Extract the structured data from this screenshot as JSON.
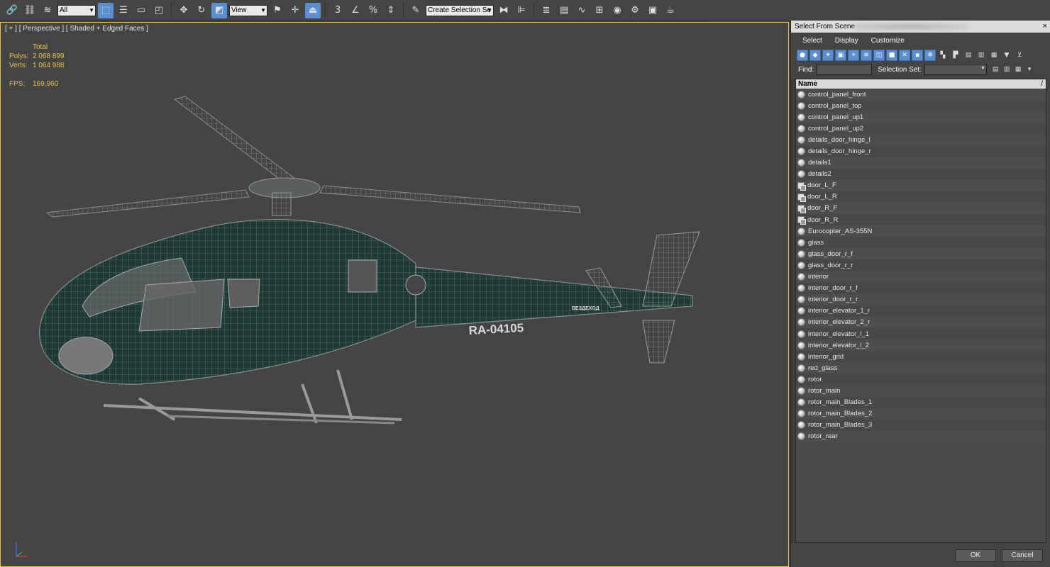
{
  "toolbar": {
    "filter_value": "All",
    "refcoord_value": "View",
    "selection_set_placeholder": "Create Selection Se",
    "snap_value": "3",
    "percent_label": "%",
    "icons": [
      "link-icon",
      "unlink-icon",
      "bind-space-warp-icon",
      "select-object-icon",
      "select-by-name-icon",
      "rect-region-icon",
      "window-crossing-icon",
      "move-icon",
      "rotate-icon",
      "scale-icon",
      "pivot-icon",
      "snap-toggle-icon",
      "angle-snap-icon",
      "percent-snap-icon",
      "spinner-snap-icon",
      "edit-named-sets-icon",
      "mirror-icon",
      "align-icon",
      "layer-manager-icon",
      "ribbon-icon",
      "curve-editor-icon",
      "schematic-icon",
      "material-editor-icon",
      "render-setup-icon",
      "render-frame-icon",
      "render-icon"
    ]
  },
  "viewport": {
    "label": "[ + ] [ Perspective ] [ Shaded + Edged Faces ]",
    "stats": {
      "total_label": "Total",
      "polys_label": "Polys:",
      "polys_value": "2 068 899",
      "verts_label": "Verts:",
      "verts_value": "1 064 988",
      "fps_label": "FPS:",
      "fps_value": "169,960"
    },
    "registration": "RA-04105",
    "tail_text": "ВЕЗДЕХОД"
  },
  "dialog": {
    "title": "Select From Scene",
    "close": "×",
    "menu": [
      "Select",
      "Display",
      "Customize"
    ],
    "find_label": "Find:",
    "selection_set_label": "Selection Set:",
    "column_name": "Name",
    "sort_indicator": "/",
    "ok": "OK",
    "cancel": "Cancel",
    "objects": [
      {
        "name": "control_panel_front",
        "type": "mesh"
      },
      {
        "name": "control_panel_top",
        "type": "mesh"
      },
      {
        "name": "control_panel_up1",
        "type": "mesh"
      },
      {
        "name": "control_panel_up2",
        "type": "mesh"
      },
      {
        "name": "details_door_hinge_l",
        "type": "mesh"
      },
      {
        "name": "details_door_hinge_r",
        "type": "mesh"
      },
      {
        "name": "details1",
        "type": "mesh"
      },
      {
        "name": "details2",
        "type": "mesh"
      },
      {
        "name": "door_L_F",
        "type": "group"
      },
      {
        "name": "door_L_R",
        "type": "group"
      },
      {
        "name": "door_R_F",
        "type": "group"
      },
      {
        "name": "door_R_R",
        "type": "group"
      },
      {
        "name": "Eurocopter_AS-355N",
        "type": "mesh"
      },
      {
        "name": "glass",
        "type": "mesh"
      },
      {
        "name": "glass_door_r_f",
        "type": "mesh"
      },
      {
        "name": "glass_door_r_r",
        "type": "mesh"
      },
      {
        "name": "interior",
        "type": "mesh"
      },
      {
        "name": "interior_door_r_f",
        "type": "mesh"
      },
      {
        "name": "interior_door_r_r",
        "type": "mesh"
      },
      {
        "name": "interior_elevator_1_r",
        "type": "mesh"
      },
      {
        "name": "interior_elevator_2_r",
        "type": "mesh"
      },
      {
        "name": "interior_elevator_l_1",
        "type": "mesh"
      },
      {
        "name": "interior_elevator_l_2",
        "type": "mesh"
      },
      {
        "name": "interior_grid",
        "type": "mesh"
      },
      {
        "name": "red_glass",
        "type": "mesh"
      },
      {
        "name": "rotor",
        "type": "mesh"
      },
      {
        "name": "rotor_main",
        "type": "mesh"
      },
      {
        "name": "rotor_main_Blades_1",
        "type": "mesh"
      },
      {
        "name": "rotor_main_Blades_2",
        "type": "mesh"
      },
      {
        "name": "rotor_main_Blades_3",
        "type": "mesh"
      },
      {
        "name": "rotor_rear",
        "type": "mesh"
      }
    ]
  },
  "colors": {
    "accent": "#5b8fd0",
    "viewport_border": "#e8c34a",
    "stats_text": "#e8c34a",
    "hull": "#1f3b38",
    "wire": "#8a8f8f"
  }
}
